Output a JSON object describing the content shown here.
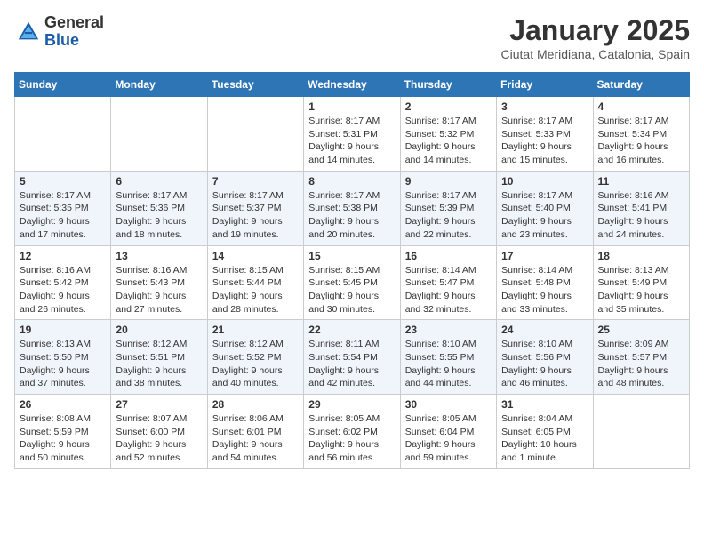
{
  "logo": {
    "general": "General",
    "blue": "Blue"
  },
  "title": "January 2025",
  "subtitle": "Ciutat Meridiana, Catalonia, Spain",
  "weekdays": [
    "Sunday",
    "Monday",
    "Tuesday",
    "Wednesday",
    "Thursday",
    "Friday",
    "Saturday"
  ],
  "weeks": [
    [
      {
        "day": "",
        "info": ""
      },
      {
        "day": "",
        "info": ""
      },
      {
        "day": "",
        "info": ""
      },
      {
        "day": "1",
        "info": "Sunrise: 8:17 AM\nSunset: 5:31 PM\nDaylight: 9 hours and 14 minutes."
      },
      {
        "day": "2",
        "info": "Sunrise: 8:17 AM\nSunset: 5:32 PM\nDaylight: 9 hours and 14 minutes."
      },
      {
        "day": "3",
        "info": "Sunrise: 8:17 AM\nSunset: 5:33 PM\nDaylight: 9 hours and 15 minutes."
      },
      {
        "day": "4",
        "info": "Sunrise: 8:17 AM\nSunset: 5:34 PM\nDaylight: 9 hours and 16 minutes."
      }
    ],
    [
      {
        "day": "5",
        "info": "Sunrise: 8:17 AM\nSunset: 5:35 PM\nDaylight: 9 hours and 17 minutes."
      },
      {
        "day": "6",
        "info": "Sunrise: 8:17 AM\nSunset: 5:36 PM\nDaylight: 9 hours and 18 minutes."
      },
      {
        "day": "7",
        "info": "Sunrise: 8:17 AM\nSunset: 5:37 PM\nDaylight: 9 hours and 19 minutes."
      },
      {
        "day": "8",
        "info": "Sunrise: 8:17 AM\nSunset: 5:38 PM\nDaylight: 9 hours and 20 minutes."
      },
      {
        "day": "9",
        "info": "Sunrise: 8:17 AM\nSunset: 5:39 PM\nDaylight: 9 hours and 22 minutes."
      },
      {
        "day": "10",
        "info": "Sunrise: 8:17 AM\nSunset: 5:40 PM\nDaylight: 9 hours and 23 minutes."
      },
      {
        "day": "11",
        "info": "Sunrise: 8:16 AM\nSunset: 5:41 PM\nDaylight: 9 hours and 24 minutes."
      }
    ],
    [
      {
        "day": "12",
        "info": "Sunrise: 8:16 AM\nSunset: 5:42 PM\nDaylight: 9 hours and 26 minutes."
      },
      {
        "day": "13",
        "info": "Sunrise: 8:16 AM\nSunset: 5:43 PM\nDaylight: 9 hours and 27 minutes."
      },
      {
        "day": "14",
        "info": "Sunrise: 8:15 AM\nSunset: 5:44 PM\nDaylight: 9 hours and 28 minutes."
      },
      {
        "day": "15",
        "info": "Sunrise: 8:15 AM\nSunset: 5:45 PM\nDaylight: 9 hours and 30 minutes."
      },
      {
        "day": "16",
        "info": "Sunrise: 8:14 AM\nSunset: 5:47 PM\nDaylight: 9 hours and 32 minutes."
      },
      {
        "day": "17",
        "info": "Sunrise: 8:14 AM\nSunset: 5:48 PM\nDaylight: 9 hours and 33 minutes."
      },
      {
        "day": "18",
        "info": "Sunrise: 8:13 AM\nSunset: 5:49 PM\nDaylight: 9 hours and 35 minutes."
      }
    ],
    [
      {
        "day": "19",
        "info": "Sunrise: 8:13 AM\nSunset: 5:50 PM\nDaylight: 9 hours and 37 minutes."
      },
      {
        "day": "20",
        "info": "Sunrise: 8:12 AM\nSunset: 5:51 PM\nDaylight: 9 hours and 38 minutes."
      },
      {
        "day": "21",
        "info": "Sunrise: 8:12 AM\nSunset: 5:52 PM\nDaylight: 9 hours and 40 minutes."
      },
      {
        "day": "22",
        "info": "Sunrise: 8:11 AM\nSunset: 5:54 PM\nDaylight: 9 hours and 42 minutes."
      },
      {
        "day": "23",
        "info": "Sunrise: 8:10 AM\nSunset: 5:55 PM\nDaylight: 9 hours and 44 minutes."
      },
      {
        "day": "24",
        "info": "Sunrise: 8:10 AM\nSunset: 5:56 PM\nDaylight: 9 hours and 46 minutes."
      },
      {
        "day": "25",
        "info": "Sunrise: 8:09 AM\nSunset: 5:57 PM\nDaylight: 9 hours and 48 minutes."
      }
    ],
    [
      {
        "day": "26",
        "info": "Sunrise: 8:08 AM\nSunset: 5:59 PM\nDaylight: 9 hours and 50 minutes."
      },
      {
        "day": "27",
        "info": "Sunrise: 8:07 AM\nSunset: 6:00 PM\nDaylight: 9 hours and 52 minutes."
      },
      {
        "day": "28",
        "info": "Sunrise: 8:06 AM\nSunset: 6:01 PM\nDaylight: 9 hours and 54 minutes."
      },
      {
        "day": "29",
        "info": "Sunrise: 8:05 AM\nSunset: 6:02 PM\nDaylight: 9 hours and 56 minutes."
      },
      {
        "day": "30",
        "info": "Sunrise: 8:05 AM\nSunset: 6:04 PM\nDaylight: 9 hours and 59 minutes."
      },
      {
        "day": "31",
        "info": "Sunrise: 8:04 AM\nSunset: 6:05 PM\nDaylight: 10 hours and 1 minute."
      },
      {
        "day": "",
        "info": ""
      }
    ]
  ]
}
